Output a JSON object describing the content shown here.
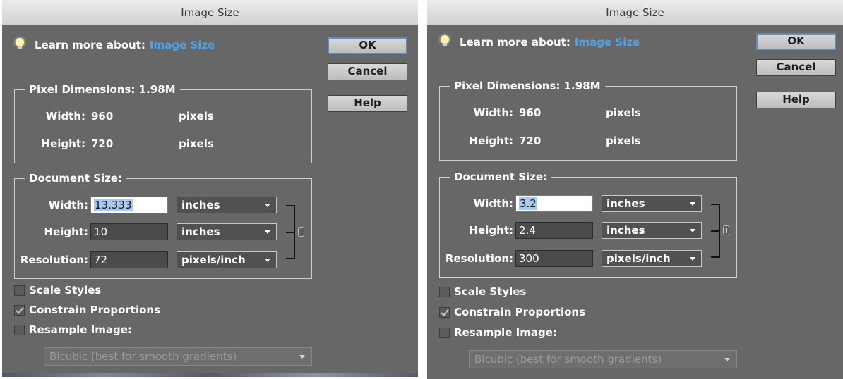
{
  "dialogs": [
    {
      "title": "Image Size",
      "tip": {
        "label": "Learn more about:",
        "link": "Image Size"
      },
      "buttons": {
        "ok": "OK",
        "cancel": "Cancel",
        "help": "Help"
      },
      "pixel_dimensions": {
        "legend": "Pixel Dimensions:  1.98M",
        "width_label": "Width:",
        "width_value": "960",
        "width_unit": "pixels",
        "height_label": "Height:",
        "height_value": "720",
        "height_unit": "pixels"
      },
      "document_size": {
        "legend": "Document Size:",
        "width_label": "Width:",
        "width_value": "13.333",
        "width_unit": "inches",
        "height_label": "Height:",
        "height_value": "10",
        "height_unit": "inches",
        "resolution_label": "Resolution:",
        "resolution_value": "72",
        "resolution_unit": "pixels/inch"
      },
      "options": {
        "scale_styles": "Scale Styles",
        "constrain_proportions": "Constrain Proportions",
        "resample_image": "Resample Image:",
        "resample_method": "Bicubic (best for smooth gradients)"
      },
      "state": {
        "scale_styles": false,
        "constrain_proportions": true,
        "resample_image": false
      }
    },
    {
      "title": "Image Size",
      "tip": {
        "label": "Learn more about:",
        "link": "Image Size"
      },
      "buttons": {
        "ok": "OK",
        "cancel": "Cancel",
        "help": "Help"
      },
      "pixel_dimensions": {
        "legend": "Pixel Dimensions:  1.98M",
        "width_label": "Width:",
        "width_value": "960",
        "width_unit": "pixels",
        "height_label": "Height:",
        "height_value": "720",
        "height_unit": "pixels"
      },
      "document_size": {
        "legend": "Document Size:",
        "width_label": "Width:",
        "width_value": "3.2",
        "width_unit": "inches",
        "height_label": "Height:",
        "height_value": "2.4",
        "height_unit": "inches",
        "resolution_label": "Resolution:",
        "resolution_value": "300",
        "resolution_unit": "pixels/inch"
      },
      "options": {
        "scale_styles": "Scale Styles",
        "constrain_proportions": "Constrain Proportions",
        "resample_image": "Resample Image:",
        "resample_method": "Bicubic (best for smooth gradients)"
      },
      "state": {
        "scale_styles": false,
        "constrain_proportions": true,
        "resample_image": false
      }
    }
  ],
  "colors": {
    "dialog_bg": "#676767",
    "link": "#4aa3ef",
    "default_button_ring": "#5b8fc4",
    "selection": "#a9c9ef"
  },
  "icons": [
    "lightbulb-icon",
    "chevron-down-icon",
    "chain-link-icon",
    "checkmark-icon"
  ]
}
